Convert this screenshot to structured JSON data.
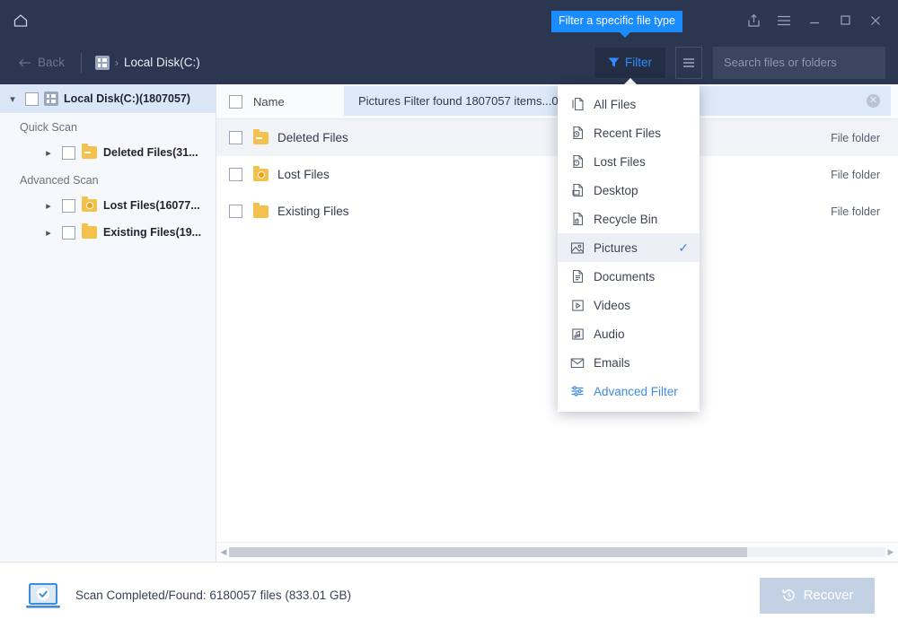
{
  "titlebar": {
    "home_icon": "home-icon",
    "controls": [
      {
        "name": "share-icon",
        "label": "Share"
      },
      {
        "name": "menu-icon",
        "label": "Menu"
      },
      {
        "name": "minimize-icon",
        "label": "Minimize"
      },
      {
        "name": "maximize-icon",
        "label": "Maximize"
      },
      {
        "name": "close-icon",
        "label": "Close"
      }
    ]
  },
  "tooltip": {
    "text": "Filter a specific file type",
    "bg": "#1a8cff",
    "color": "#ffffff"
  },
  "toolbar": {
    "back_label": "Back",
    "breadcrumb": "Local Disk(C:)",
    "breadcrumb_separator": "›",
    "filter_label": "Filter",
    "filter_accent": "#2f8bff",
    "list_view_icon": "list-view-icon",
    "search_placeholder": "Search files or folders",
    "search_value": ""
  },
  "sidebar": {
    "root": {
      "label": "Local Disk(C:)(1807057)",
      "expanded": true
    },
    "groups": [
      {
        "label": "Quick Scan",
        "items": [
          {
            "label": "Deleted Files(31...",
            "icon": "folder-minus-icon"
          }
        ]
      },
      {
        "label": "Advanced Scan",
        "items": [
          {
            "label": "Lost Files(16077...",
            "icon": "folder-warning-icon"
          },
          {
            "label": "Existing Files(19...",
            "icon": "folder-icon"
          }
        ]
      }
    ]
  },
  "filelist": {
    "column_name": "Name",
    "notification": "Pictures Filter found 1807057 items...00)",
    "rows": [
      {
        "name": "Deleted Files",
        "type": "File folder",
        "icon": "folder-minus-icon"
      },
      {
        "name": "Lost Files",
        "type": "File folder",
        "icon": "folder-warning-icon"
      },
      {
        "name": "Existing Files",
        "type": "File folder",
        "icon": "folder-icon"
      }
    ]
  },
  "dropdown": {
    "items": [
      {
        "label": "All Files",
        "icon": "all-files-icon",
        "selected": false
      },
      {
        "label": "Recent Files",
        "icon": "recent-files-icon",
        "selected": false
      },
      {
        "label": "Lost Files",
        "icon": "lost-files-icon",
        "selected": false
      },
      {
        "label": "Desktop",
        "icon": "desktop-icon",
        "selected": false
      },
      {
        "label": "Recycle Bin",
        "icon": "recycle-bin-icon",
        "selected": false
      },
      {
        "label": "Pictures",
        "icon": "pictures-icon",
        "selected": true
      },
      {
        "label": "Documents",
        "icon": "documents-icon",
        "selected": false
      },
      {
        "label": "Videos",
        "icon": "videos-icon",
        "selected": false
      },
      {
        "label": "Audio",
        "icon": "audio-icon",
        "selected": false
      },
      {
        "label": "Emails",
        "icon": "emails-icon",
        "selected": false
      },
      {
        "label": "Advanced Filter",
        "icon": "advanced-filter-icon",
        "selected": false,
        "accent": true
      }
    ],
    "check_glyph": "✓",
    "accent": "#3f8ae0"
  },
  "footer": {
    "status": "Scan Completed/Found: 6180057 files (833.01 GB)",
    "recover_label": "Recover",
    "recover_enabled": false
  }
}
